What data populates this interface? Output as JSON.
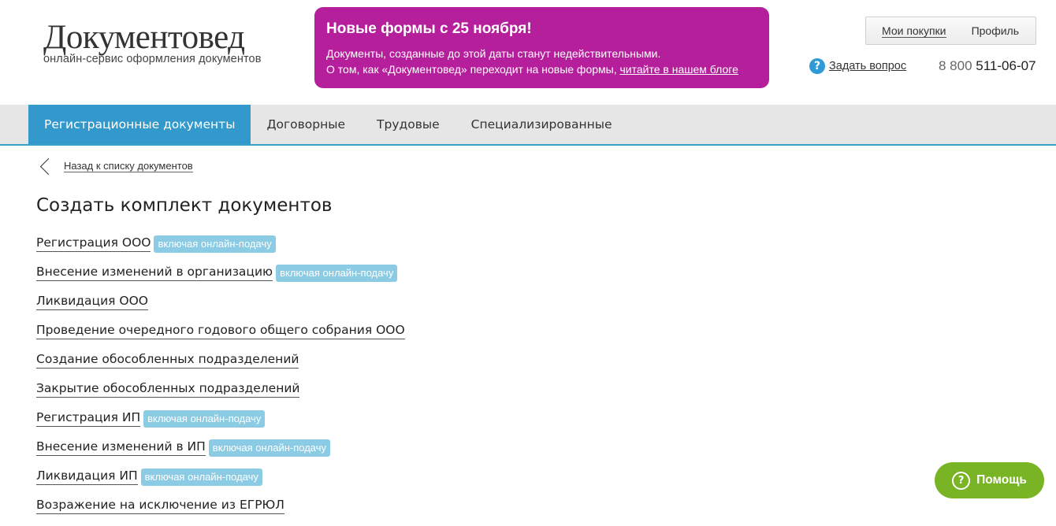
{
  "logo": {
    "title": "Документовед",
    "subtitle": "онлайн-сервис оформления документов"
  },
  "promo": {
    "title": "Новые формы с 25 ноября!",
    "line1": "Документы, созданные до этой даты станут недействительными.",
    "line2_prefix": "О том, как «Документовед» переходит на новые формы,",
    "line2_link": "читайте в нашем блоге",
    "color": "#b61f9b"
  },
  "user_menu": {
    "purchases": "Мои покупки",
    "profile": "Профиль"
  },
  "ask": {
    "icon": "?",
    "label": "Задать вопрос"
  },
  "phone": {
    "prefix": "8 800",
    "number": "511-06-07"
  },
  "nav": {
    "items": [
      {
        "label": "Регистрационные документы",
        "active": true
      },
      {
        "label": "Договорные",
        "active": false
      },
      {
        "label": "Трудовые",
        "active": false
      },
      {
        "label": "Специализированные",
        "active": false
      }
    ],
    "accent": "#3399cc"
  },
  "back": {
    "label": "Назад к списку документов"
  },
  "page_title": "Создать комплект документов",
  "documents": [
    {
      "label": "Регистрация ООО",
      "badge": "включая онлайн-подачу"
    },
    {
      "label": "Внесение изменений в организацию",
      "badge": "включая онлайн-подачу"
    },
    {
      "label": "Ликвидация ООО",
      "badge": ""
    },
    {
      "label": "Проведение очередного годового общего собрания ООО",
      "badge": ""
    },
    {
      "label": "Создание обособленных подразделений",
      "badge": ""
    },
    {
      "label": "Закрытие обособленных подразделений",
      "badge": ""
    },
    {
      "label": "Регистрация ИП",
      "badge": "включая онлайн-подачу"
    },
    {
      "label": "Внесение изменений в ИП",
      "badge": "включая онлайн-подачу"
    },
    {
      "label": "Ликвидация ИП",
      "badge": "включая онлайн-подачу"
    },
    {
      "label": "Возражение на исключение из ЕГРЮЛ",
      "badge": ""
    }
  ],
  "help_button": {
    "icon": "?",
    "label": "Помощь",
    "color": "#78b424"
  }
}
